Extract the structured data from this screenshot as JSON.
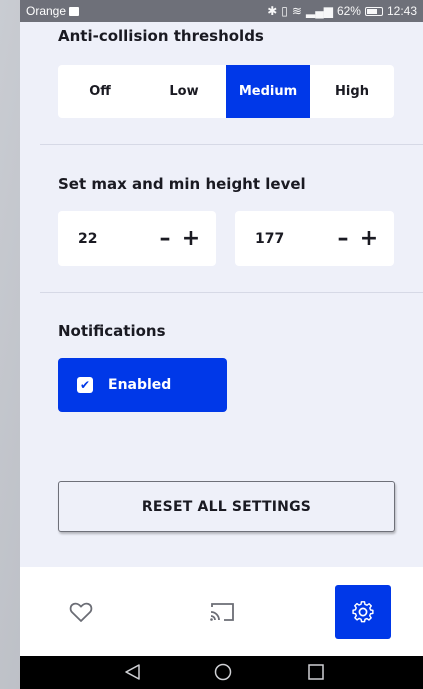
{
  "status_bar": {
    "carrier": "Orange",
    "battery": "62%",
    "time": "12:43"
  },
  "thresholds": {
    "title": "Anti-collision thresholds",
    "options": [
      "Off",
      "Low",
      "Medium",
      "High"
    ],
    "selected": "Medium"
  },
  "height": {
    "title": "Set max and min height level",
    "min": {
      "value": "22",
      "minus": "–",
      "plus": "+"
    },
    "max": {
      "value": "177",
      "minus": "–",
      "plus": "+"
    }
  },
  "notifications": {
    "title": "Notifications",
    "toggle_label": "Enabled",
    "checked": true
  },
  "reset_label": "RESET ALL SETTINGS",
  "bottom_nav": {
    "items": [
      "heart-icon",
      "cast-icon",
      "gear-icon"
    ],
    "active": "gear-icon"
  },
  "system_nav": [
    "back-icon",
    "home-icon",
    "recents-icon"
  ],
  "colors": {
    "accent": "#0038e8",
    "background": "#eef0f9",
    "status_bar": "#6e7079"
  }
}
